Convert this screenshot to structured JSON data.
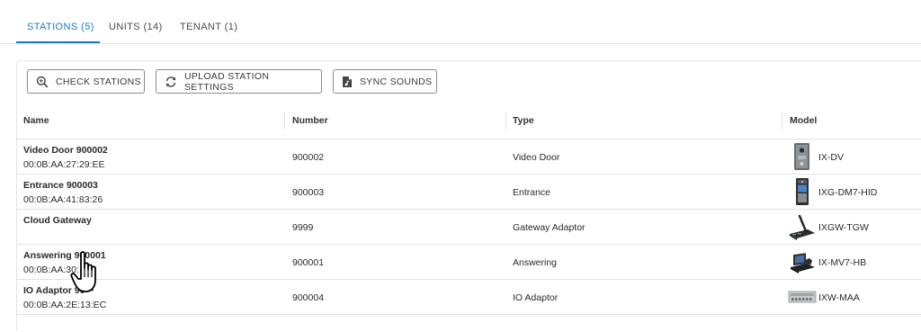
{
  "tabs": [
    {
      "label": "STATIONS (5)",
      "active": true
    },
    {
      "label": "UNITS (14)",
      "active": false
    },
    {
      "label": "TENANT (1)",
      "active": false
    }
  ],
  "toolbar": {
    "check_label": "CHECK STATIONS",
    "upload_label": "UPLOAD STATION SETTINGS",
    "sync_label": "SYNC SOUNDS"
  },
  "table": {
    "columns": [
      "Name",
      "Number",
      "Type",
      "Model"
    ],
    "rows": [
      {
        "name": "Video Door 900002",
        "mac": "00:0B:AA:27:29:EE",
        "number": "900002",
        "type": "Video Door",
        "model": "IX-DV",
        "icon": "door-station-icon"
      },
      {
        "name": "Entrance 900003",
        "mac": "00:0B:AA:41:83:26",
        "number": "900003",
        "type": "Entrance",
        "model": "IXG-DM7-HID",
        "icon": "entrance-station-icon"
      },
      {
        "name": "Cloud Gateway",
        "mac": "",
        "number": "9999",
        "type": "Gateway Adaptor",
        "model": "IXGW-TGW",
        "icon": "gateway-antenna-icon"
      },
      {
        "name": "Answering 900001",
        "mac": "00:0B:AA:30:··:·8",
        "number": "900001",
        "type": "Answering",
        "model": "IX-MV7-HB",
        "icon": "master-station-icon"
      },
      {
        "name": "IO Adaptor 90···",
        "mac": "00:0B:AA:2E:13:EC",
        "number": "900004",
        "type": "IO Adaptor",
        "model": "IXW-MAA",
        "icon": "io-adaptor-icon"
      }
    ]
  },
  "colors": {
    "accent": "#1b7ac4",
    "border": "#e2e2e2"
  }
}
